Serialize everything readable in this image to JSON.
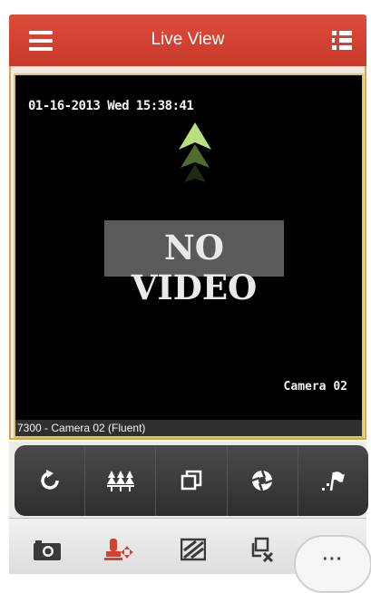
{
  "header": {
    "title": "Live View"
  },
  "video": {
    "osd_datetime": "01-16-2013 Wed 15:38:41",
    "no_video_text": "NO VIDEO",
    "osd_camera": "Camera 02",
    "caption": "7300 - Camera 02 (Fluent)"
  },
  "toolbar": {
    "icons": [
      "refresh-icon",
      "tree-icon",
      "window-icon",
      "aperture-icon",
      "flag-icon"
    ]
  },
  "bottom_tabs": {
    "icons": [
      "camera-icon",
      "ptz-icon",
      "image-icon",
      "close-window-icon"
    ],
    "more_label": "···"
  },
  "colors": {
    "header": "#d54131",
    "accent": "#e2c45f",
    "toolbar": "#3c3c3c",
    "active_tab": "#d54131"
  }
}
